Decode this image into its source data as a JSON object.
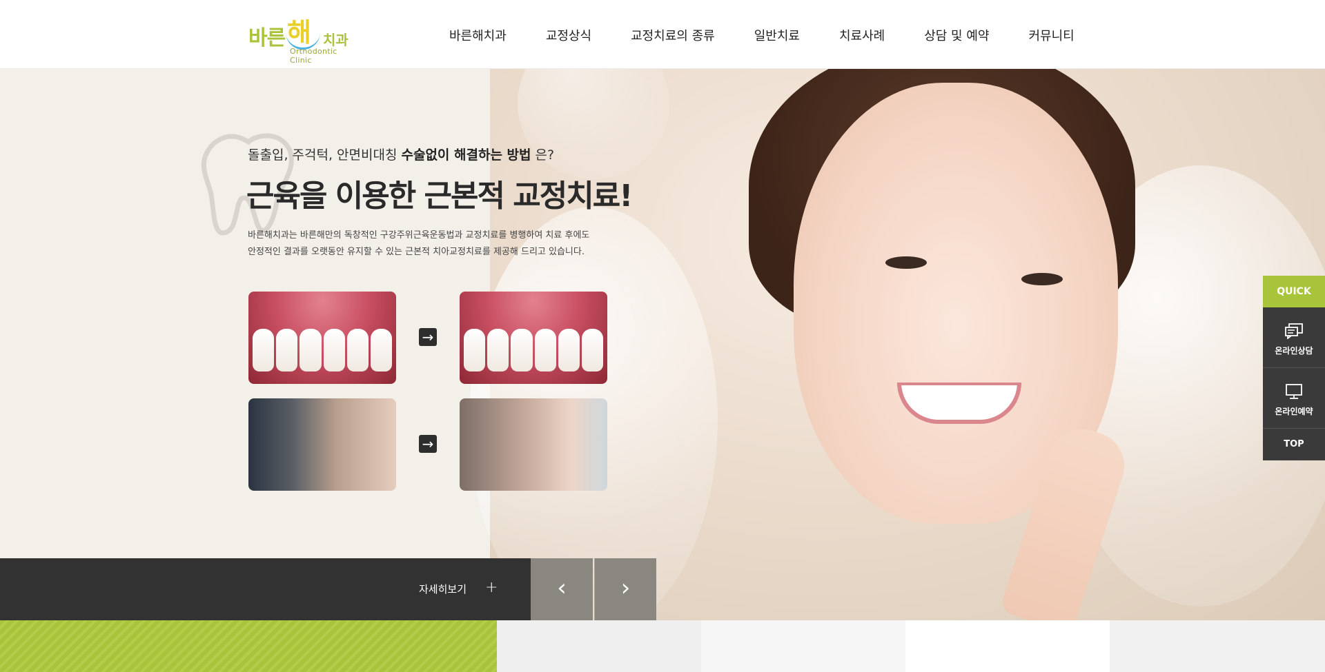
{
  "header": {
    "logo": {
      "text_ko": "바른",
      "text_big": "해",
      "text_small": "치과",
      "text_en": "Orthodontic Clinic"
    },
    "nav": [
      "바른해치과",
      "교정상식",
      "교정치료의 종류",
      "일반치료",
      "치료사례",
      "상담 및 예약",
      "커뮤니티"
    ]
  },
  "hero": {
    "subtitle_prefix": "돌출입, 주걱턱, 안면비대칭 ",
    "subtitle_strong": "수술없이 해결하는 방법",
    "subtitle_suffix": " 은?",
    "title": "근육을 이용한 근본적 교정치료!",
    "desc_line1": "바른해치과는 바른해만의 독창적인 구강주위근육운동법과 교정치료를 병행하여 치료 후에도",
    "desc_line2": "안정적인 결과를 오랫동안 유지할 수 있는 근본적 치아교정치료를 제공해 드리고 있습니다.",
    "more_label": "자세히보기",
    "plus_symbol": "+",
    "prev_symbol": "‹",
    "next_symbol": "›",
    "arrow_symbol": "→"
  },
  "quick_menu": {
    "title": "QUICK",
    "items": [
      "온라인상담",
      "온라인예약"
    ],
    "top": "TOP"
  },
  "colors": {
    "accent_green": "#a8c43a",
    "dark": "#323232",
    "gray_ctrl": "#8a8780"
  }
}
